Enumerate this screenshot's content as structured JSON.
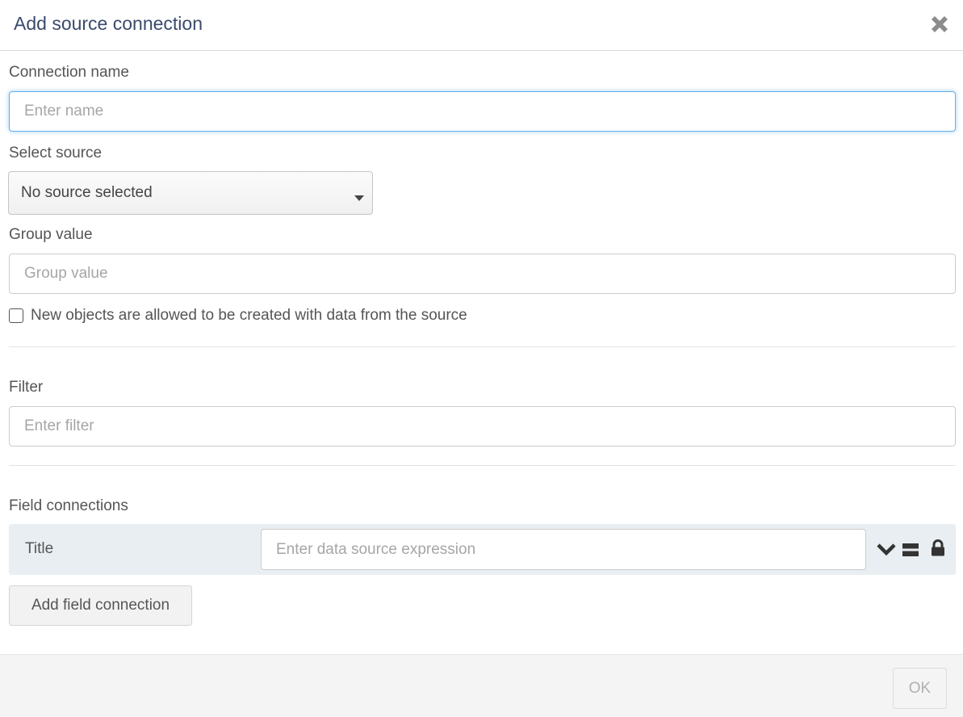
{
  "dialog": {
    "title": "Add source connection",
    "close_icon": "close-icon"
  },
  "connection_name": {
    "label": "Connection name",
    "placeholder": "Enter name",
    "value": ""
  },
  "source": {
    "label": "Select source",
    "selected": "No source selected",
    "caret_icon": "caret-down-icon"
  },
  "group_value": {
    "label": "Group value",
    "placeholder": "Group value",
    "value": ""
  },
  "allow_create": {
    "label": "New objects are allowed to be created with data from the source",
    "checked": false
  },
  "filter": {
    "label": "Filter",
    "placeholder": "Enter filter",
    "value": ""
  },
  "field_connections": {
    "label": "Field connections",
    "rows": [
      {
        "name": "Title",
        "placeholder": "Enter data source expression",
        "value": "",
        "icons": [
          "chevron-down-icon",
          "equals-icon",
          "lock-icon"
        ]
      }
    ],
    "add_label": "Add field connection"
  },
  "footer": {
    "ok_label": "OK"
  },
  "colors": {
    "title": "#3b4a6b",
    "focus_border": "#66afe9",
    "row_background": "#e9eef2",
    "footer_background": "#f4f4f4"
  }
}
